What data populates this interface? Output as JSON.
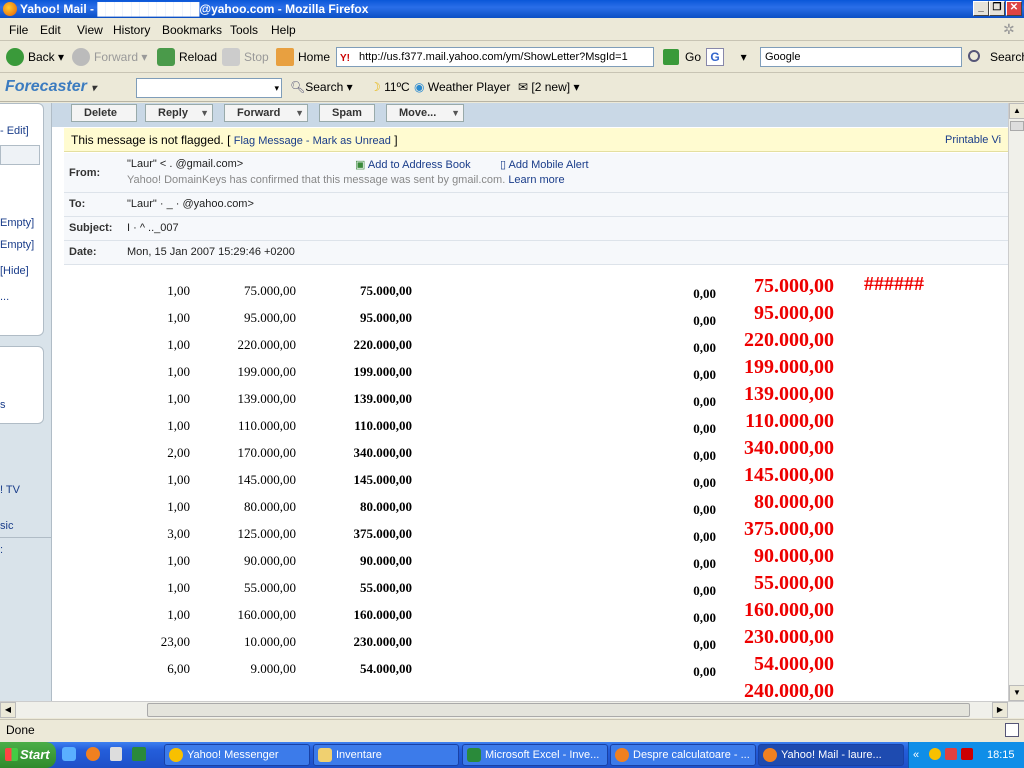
{
  "window": {
    "title": "Yahoo! Mail - ████████████@yahoo.com - Mozilla Firefox"
  },
  "menu": [
    "File",
    "Edit",
    "View",
    "History",
    "Bookmarks",
    "Tools",
    "Help"
  ],
  "nav": {
    "back": "Back",
    "forward": "Forward",
    "reload": "Reload",
    "stop": "Stop",
    "home": "Home",
    "url": "http://us.f377.mail.yahoo.com/ym/ShowLetter?MsgId=1",
    "go": "Go",
    "search_value": "Google",
    "search_btn": "Search"
  },
  "forecaster": {
    "brand": "Forecaster",
    "search": "Search",
    "temp": "11ºC",
    "weather": "Weather Player",
    "mail": "[2 new]"
  },
  "sidebar": [
    "- Edit]",
    "Empty]",
    "Empty]",
    "[Hide]",
    "...",
    "s",
    "! TV",
    "sic",
    ":"
  ],
  "actions": [
    "Delete",
    "Reply",
    "Forward",
    "Spam",
    "Move..."
  ],
  "flag": {
    "text": "This message is not flagged. [",
    "flag_link": "Flag Message",
    "sep": " - ",
    "unread_link": "Mark as Unread",
    "close": " ]",
    "printable": "Printable Vi"
  },
  "headers": {
    "from_label": "From:",
    "from_value": "\"Laur\" <  .                              @gmail.com>",
    "add_book": "Add to Address Book",
    "mobile": "Add Mobile Alert",
    "domainkeys": "Yahoo! DomainKeys has confirmed that this message was sent by gmail.com.",
    "learn": "Learn more",
    "to_label": "To:",
    "to_value": "\"Laur\" ·            _  ·          @yahoo.com>",
    "subject_label": "Subject:",
    "subject_value": "I                ·       ^    .._007",
    "date_label": "Date:",
    "date_value": "Mon, 15 Jan 2007 15:29:46 +0200"
  },
  "hashes": "######",
  "rows": [
    {
      "qty": "1,00",
      "price": "75.000,00",
      "total": "75.000,00",
      "zero": "0,00",
      "red": "75.000,00"
    },
    {
      "qty": "1,00",
      "price": "95.000,00",
      "total": "95.000,00",
      "zero": "0,00",
      "red": "95.000,00"
    },
    {
      "qty": "1,00",
      "price": "220.000,00",
      "total": "220.000,00",
      "zero": "0,00",
      "red": "220.000,00"
    },
    {
      "qty": "1,00",
      "price": "199.000,00",
      "total": "199.000,00",
      "zero": "0,00",
      "red": "199.000,00"
    },
    {
      "qty": "1,00",
      "price": "139.000,00",
      "total": "139.000,00",
      "zero": "0,00",
      "red": "139.000,00"
    },
    {
      "qty": "1,00",
      "price": "110.000,00",
      "total": "110.000,00",
      "zero": "0,00",
      "red": "110.000,00"
    },
    {
      "qty": "2,00",
      "price": "170.000,00",
      "total": "340.000,00",
      "zero": "0,00",
      "red": "340.000,00"
    },
    {
      "qty": "1,00",
      "price": "145.000,00",
      "total": "145.000,00",
      "zero": "0,00",
      "red": "145.000,00"
    },
    {
      "qty": "1,00",
      "price": "80.000,00",
      "total": "80.000,00",
      "zero": "0,00",
      "red": "80.000,00"
    },
    {
      "qty": "3,00",
      "price": "125.000,00",
      "total": "375.000,00",
      "zero": "0,00",
      "red": "375.000,00"
    },
    {
      "qty": "1,00",
      "price": "90.000,00",
      "total": "90.000,00",
      "zero": "0,00",
      "red": "90.000,00"
    },
    {
      "qty": "1,00",
      "price": "55.000,00",
      "total": "55.000,00",
      "zero": "0,00",
      "red": "55.000,00"
    },
    {
      "qty": "1,00",
      "price": "160.000,00",
      "total": "160.000,00",
      "zero": "0,00",
      "red": "160.000,00"
    },
    {
      "qty": "23,00",
      "price": "10.000,00",
      "total": "230.000,00",
      "zero": "0,00",
      "red": "230.000,00"
    },
    {
      "qty": "6,00",
      "price": "9.000,00",
      "total": "54.000,00",
      "zero": "0,00",
      "red": "54.000,00"
    },
    {
      "qty": "",
      "price": "",
      "total": "",
      "zero": "",
      "red": "240.000,00"
    }
  ],
  "status": "Done",
  "taskbar": {
    "start": "Start",
    "tasks": [
      "Yahoo! Messenger",
      "Inventare",
      "Microsoft Excel - Inve...",
      "Despre calculatoare - ...",
      "Yahoo! Mail - laure..."
    ],
    "clock": "18:15"
  }
}
